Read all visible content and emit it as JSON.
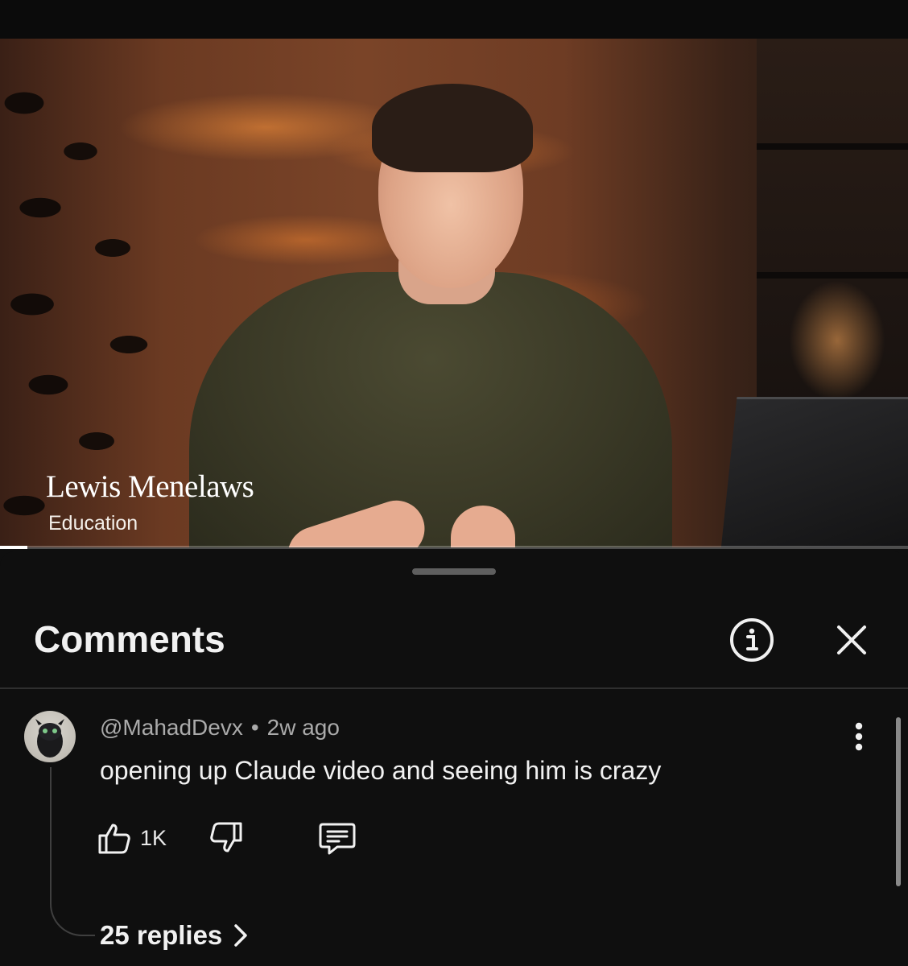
{
  "video": {
    "overlay_name": "Lewis Menelaws",
    "overlay_subtitle": "Education",
    "progress": 0.03
  },
  "comments_panel": {
    "title": "Comments",
    "info_icon": "info-icon",
    "close_icon": "close-icon"
  },
  "comment": {
    "author": "@MahadDevx",
    "separator": "•",
    "time": "2w ago",
    "text": "opening up Claude video and seeing him is crazy",
    "like_count": "1K",
    "replies_label": "25 replies",
    "icons": [
      "thumbs-up-icon",
      "thumbs-down-icon",
      "reply-icon",
      "more-vertical-icon",
      "chevron-right-icon"
    ]
  },
  "colors": {
    "background": "#0f0f0f",
    "text_primary": "#f1f1f1",
    "text_secondary": "#aaaaaa",
    "divider": "#2f2f2f"
  }
}
